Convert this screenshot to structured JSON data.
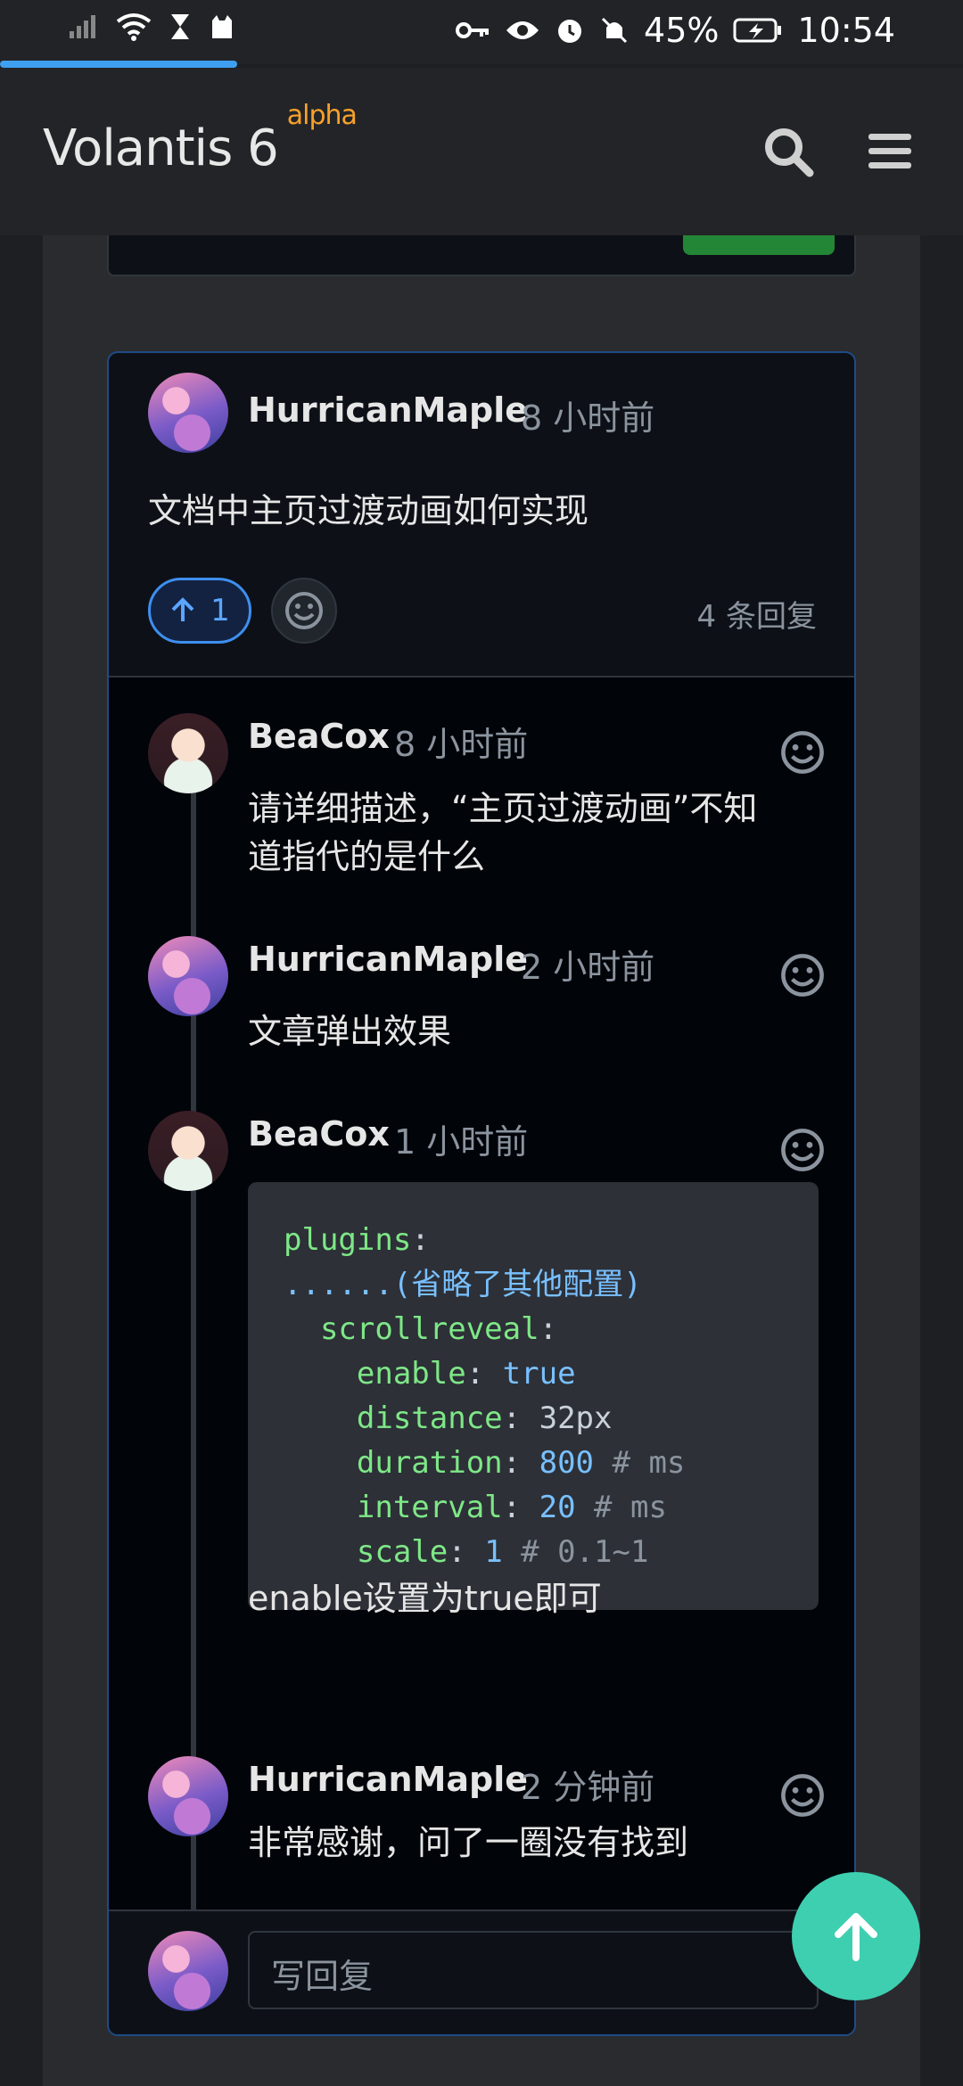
{
  "status": {
    "battery": "45%",
    "time": "10:54"
  },
  "header": {
    "brand": "Volantis 6",
    "badge": "alpha"
  },
  "topic": {
    "author": "HurricanMaple",
    "time": "8 小时前",
    "title": "文档中主页过渡动画如何实现",
    "upvotes": "1",
    "reply_count": "4 条回复"
  },
  "replies": [
    {
      "author": "BeaCox",
      "time": "8 小时前",
      "text_line1": "请详细描述，“主页过渡动画”不知",
      "text_line2": "道指代的是什么"
    },
    {
      "author": "HurricanMaple",
      "time": "2 小时前",
      "text": "文章弹出效果"
    },
    {
      "author": "BeaCox",
      "time": "1 小时前",
      "after_code": "enable设置为true即可"
    },
    {
      "author": "HurricanMaple",
      "time": "2 分钟前",
      "text": "非常感谢，问了一圈没有找到"
    }
  ],
  "code": {
    "l1": "plugins",
    "l2": "......(省略了其他配置)",
    "l3": "scrollreveal",
    "enable_key": "enable",
    "enable_val": "true",
    "distance_key": "distance",
    "distance_val": "32px",
    "duration_key": "duration",
    "duration_val": "800",
    "duration_cmt": "# ms",
    "interval_key": "interval",
    "interval_val": "20",
    "interval_cmt": "# ms",
    "scale_key": "scale",
    "scale_val": "1",
    "scale_cmt": "# 0.1~1"
  },
  "reply_box": {
    "placeholder": "写回复"
  },
  "icons": [
    "signal-icon",
    "wifi-icon",
    "hourglass-icon",
    "cat-icon",
    "key-icon",
    "eye-icon",
    "alarm-icon",
    "mute-icon",
    "battery-icon",
    "search-icon",
    "menu-icon",
    "arrow-up-icon",
    "smiley-icon"
  ]
}
